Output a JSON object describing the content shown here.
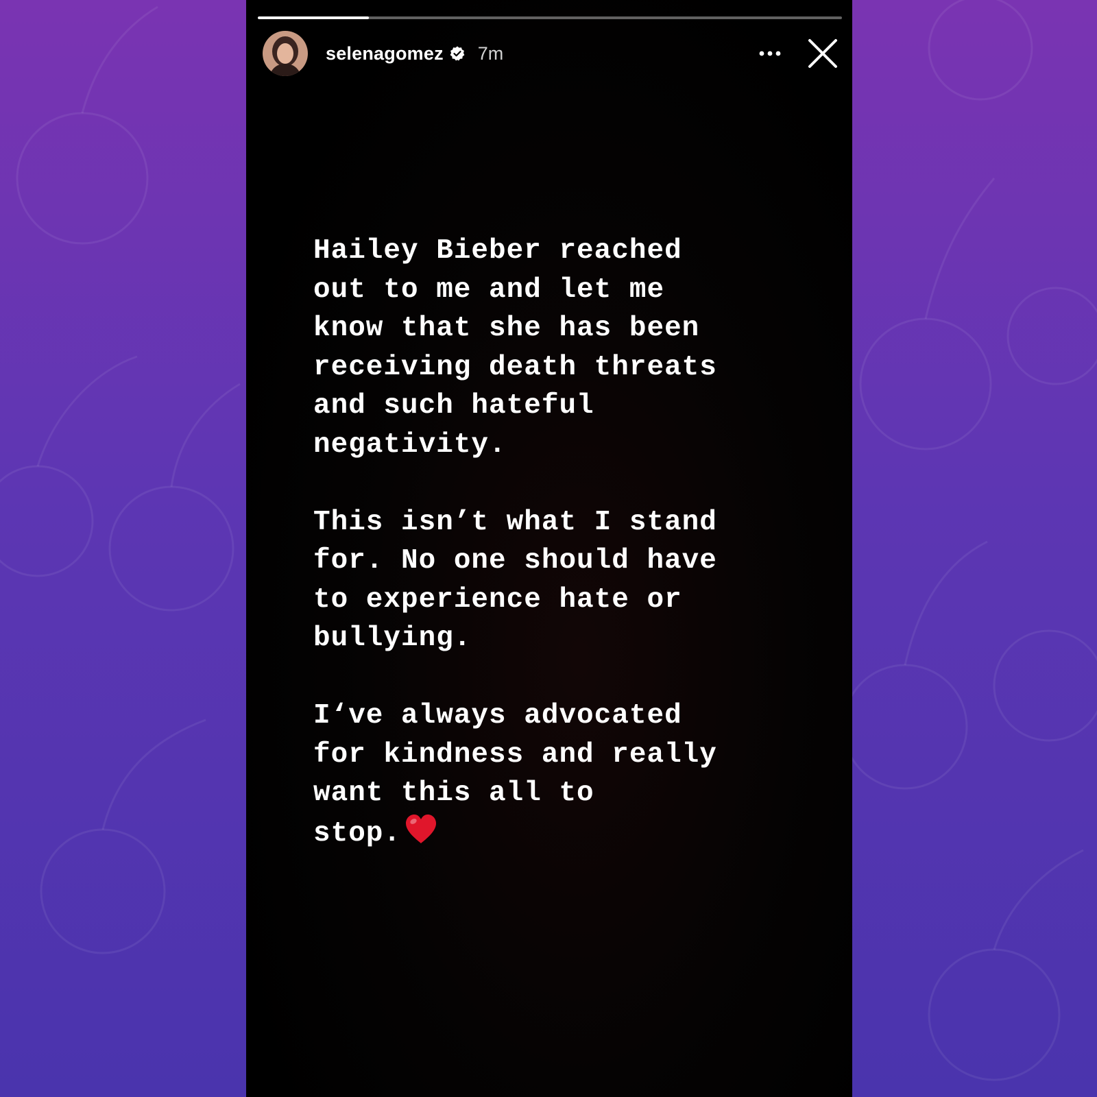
{
  "story": {
    "username": "selenagomez",
    "time_ago": "7m",
    "progress": 0.19,
    "paragraphs": [
      [
        "Hailey Bieber reached",
        "out to me and let me",
        "know that she has been",
        "receiving death threats",
        "and such hateful",
        "negativity."
      ],
      [
        "This isn’t what I stand",
        "for. No one should have",
        "to experience hate or",
        "bullying."
      ],
      [
        "I‘ve always advocated",
        "for kindness and really",
        "want this all to",
        "stop."
      ]
    ]
  },
  "icons": {
    "verified": "verified-badge-icon",
    "more": "more-options-icon",
    "close": "close-icon",
    "heart": "red-heart-emoji",
    "background": "cherry-outline-pattern"
  },
  "colors": {
    "background_top": "#7a34b2",
    "background_bottom": "#4a34ad",
    "story_bg": "#000000",
    "text": "#ffffff",
    "heart": "#e0162b"
  }
}
